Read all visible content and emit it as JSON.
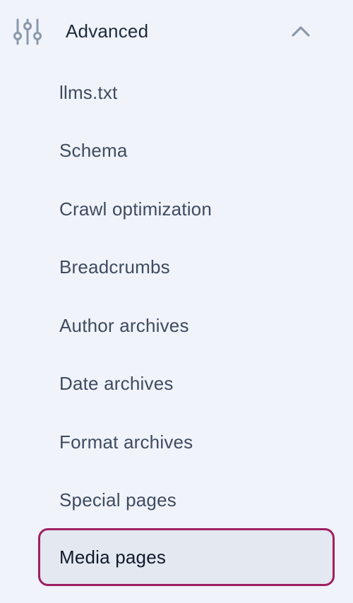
{
  "section": {
    "title": "Advanced",
    "icon": "sliders-icon",
    "toggle_icon": "chevron-up-icon",
    "expanded": true
  },
  "colors": {
    "background": "#f0f3f9",
    "title_text": "#1e2a3c",
    "item_text": "#3e4b61",
    "icon": "#8a98ad",
    "active_border": "#9e1f63",
    "active_background": "#e4e8f1"
  },
  "submenu": {
    "items": [
      {
        "label": "llms.txt"
      },
      {
        "label": "Schema"
      },
      {
        "label": "Crawl optimization"
      },
      {
        "label": "Breadcrumbs"
      },
      {
        "label": "Author archives"
      },
      {
        "label": "Date archives"
      },
      {
        "label": "Format archives"
      },
      {
        "label": "Special pages"
      },
      {
        "label": "Media pages",
        "active": true
      }
    ]
  }
}
